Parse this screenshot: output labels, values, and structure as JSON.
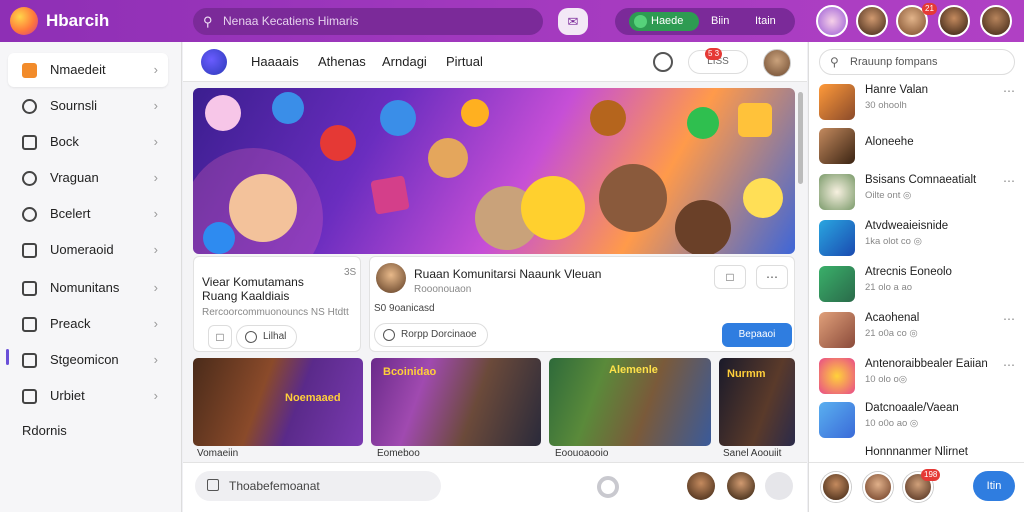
{
  "app": {
    "brand": "Hbarcih"
  },
  "search": {
    "placeholder": "Nenaa Kecatiens Himaris"
  },
  "topbar": {
    "pill_green": "Haede",
    "pill_a": "Biin",
    "pill_b": "Itain",
    "badge": "21"
  },
  "sidebar": {
    "items": [
      {
        "label": "Nmaedeit",
        "icon": "home-icon"
      },
      {
        "label": "Sournsli",
        "icon": "sound-icon"
      },
      {
        "label": "Bock",
        "icon": "book-icon"
      },
      {
        "label": "Vraguan",
        "icon": "video-icon"
      },
      {
        "label": "Bcelert",
        "icon": "bell-icon"
      },
      {
        "label": "Uomeraoid",
        "icon": "group-icon"
      },
      {
        "label": "Nomunitans",
        "icon": "community-icon"
      },
      {
        "label": "Preack",
        "icon": "bookmark-icon"
      },
      {
        "label": "Stgeomicon",
        "icon": "settings-icon"
      },
      {
        "label": "Urbiet",
        "icon": "event-icon"
      }
    ],
    "footer": "Rdornis"
  },
  "nav": {
    "tabs": [
      "Haaaais",
      "Athenas",
      "Arndagi",
      "Pirtual"
    ],
    "notif_label": "LISS",
    "notif_badge": "5 3"
  },
  "card1": {
    "title": "Viear Komutamans Ruang Kaaldiais",
    "subtitle": "Rercoorcommuonouncs NS Htdtt",
    "button": "Lilhal",
    "counter": "3S"
  },
  "card2": {
    "title": "Ruaan Komunitarsi Naaunk Vleuan",
    "subtitle": "Rooonouaon",
    "meta": "S0 9oanicasd",
    "button": "Rorpp Dorcinaoe",
    "cta": "Bepaaoi"
  },
  "thumbs": [
    {
      "caption": "Vomaeiin",
      "banner": "Noemaaed"
    },
    {
      "caption": "Eomeboo",
      "banner": "Bcoinidao"
    },
    {
      "caption": "Eoouoaooio",
      "banner": "Alemenle"
    },
    {
      "caption": "Sanel Aoouiit",
      "banner": "Nurmm"
    }
  ],
  "composer": {
    "placeholder": "Thoabefemoanat"
  },
  "right": {
    "search_placeholder": "Rrauunp fompans",
    "items": [
      {
        "name": "Hanre Valan",
        "sub": "30 ohoolh"
      },
      {
        "name": "Aloneehe",
        "sub": ""
      },
      {
        "name": "Bsisans Comnaeatialt",
        "sub": "Oilte ont ◎"
      },
      {
        "name": "Atvdweaieisnide",
        "sub": "1ka olot co ◎"
      },
      {
        "name": "Atrecnis Eoneolo",
        "sub": "21 olo a ao"
      },
      {
        "name": "Acaohenal",
        "sub": "21 o0a co ◎"
      },
      {
        "name": "Antenoraibbealer Eaiian",
        "sub": "10 olo o◎"
      },
      {
        "name": "Datcnoaale/Vaean",
        "sub": "10 o0o ao ◎"
      },
      {
        "name": "Honnnanmer Nlirnet",
        "sub": ""
      }
    ],
    "bottom_badge": "198",
    "button": "Itin"
  }
}
